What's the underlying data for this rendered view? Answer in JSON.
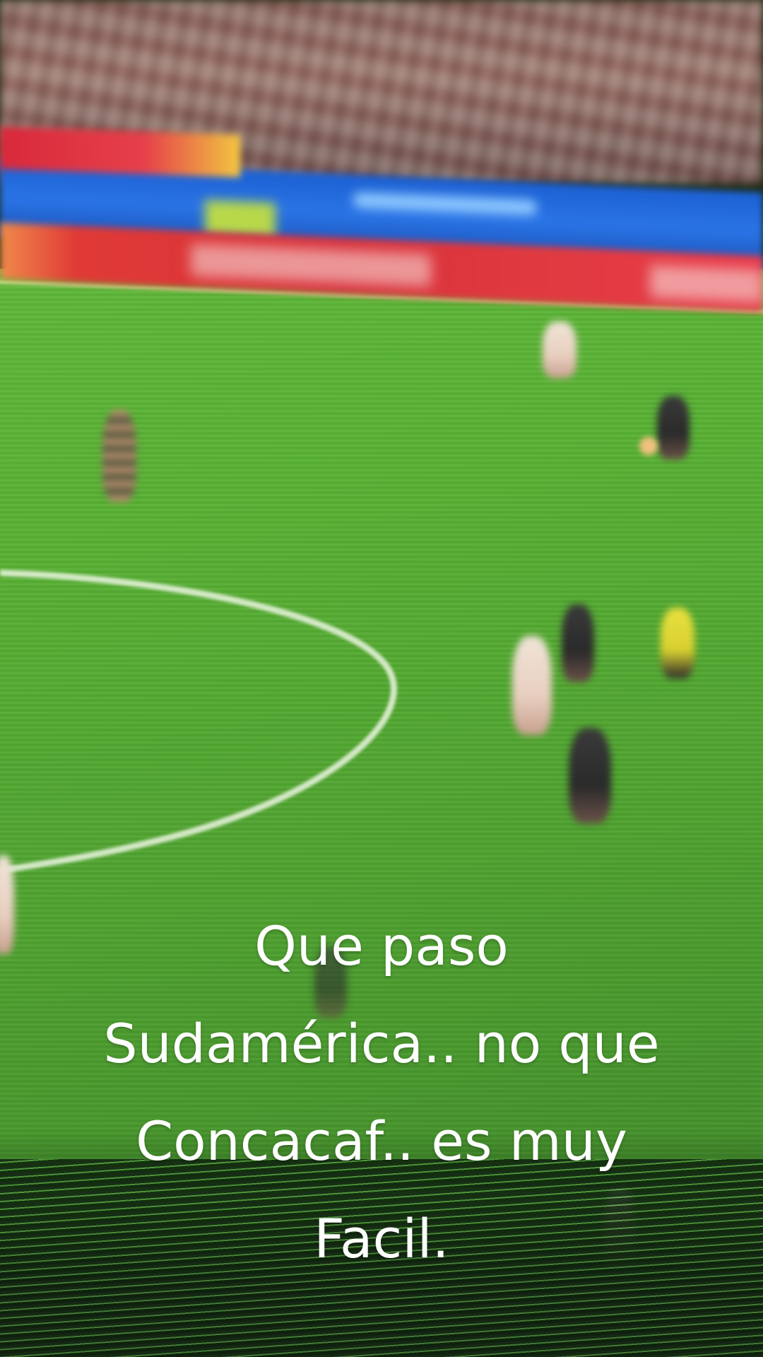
{
  "caption": {
    "lines": [
      "Que paso",
      "Sudamérica.. no que",
      "Concacaf.. es muy",
      "Facil."
    ]
  },
  "colors": {
    "pitch_green": "#53aa33",
    "board_blue": "#2a74e6",
    "board_red": "#d8303a",
    "caption_text": "#ffffff"
  }
}
